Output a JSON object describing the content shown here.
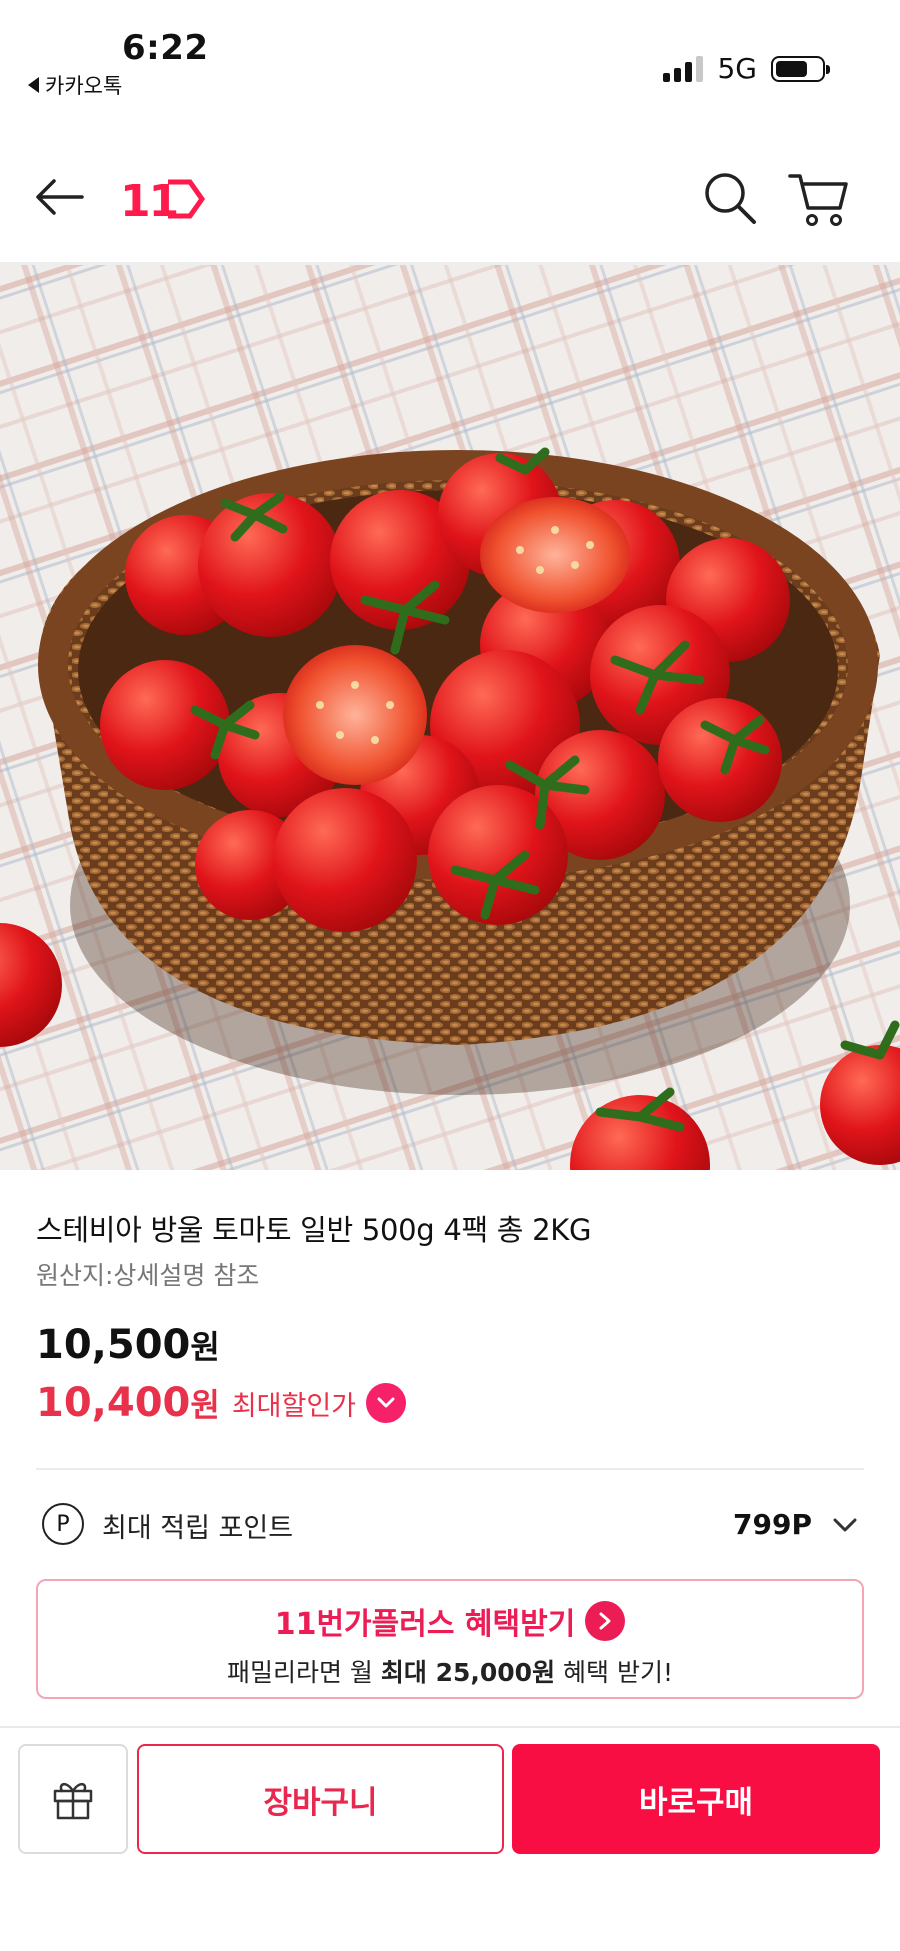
{
  "status_bar": {
    "time": "6:22",
    "back_app": "카카오톡",
    "network": "5G"
  },
  "header": {
    "logo_text": "11",
    "icons": [
      "back-arrow-icon",
      "search-icon",
      "cart-icon"
    ]
  },
  "product": {
    "title": "스테비아 방울 토마토 일반 500g 4팩 총 2KG",
    "origin": "원산지:상세설명 참조",
    "price_original": "10,500",
    "price_discount": "10,400",
    "currency_unit": "원",
    "discount_label": "최대할인가"
  },
  "points": {
    "icon_letter": "P",
    "label": "최대 적립 포인트",
    "value": "799P"
  },
  "promo": {
    "title": "11번가플러스 혜택받기",
    "subtitle_pre": "패밀리라면 월 ",
    "subtitle_bold": "최대 25,000원",
    "subtitle_post": " 혜택 받기!"
  },
  "bottom_bar": {
    "cart_label": "장바구니",
    "buy_label": "바로구매"
  },
  "colors": {
    "accent": "#f80e43",
    "discount": "#e8324b",
    "promo": "#ec1c55"
  }
}
